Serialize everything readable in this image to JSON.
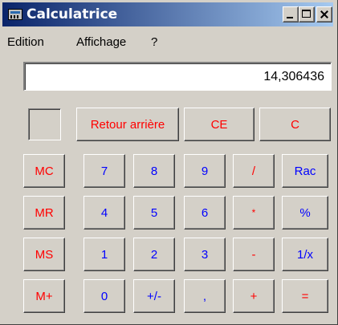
{
  "window": {
    "title": "Calculatrice",
    "icon": "calculator-icon"
  },
  "menu": {
    "edition": "Edition",
    "affichage": "Affichage",
    "help": "?"
  },
  "display": {
    "value": "14,306436"
  },
  "colors": {
    "title_gradient_start": "#0a246a",
    "title_gradient_end": "#a6caf0",
    "red_label": "#ff0000",
    "blue_label": "#0000ff",
    "face": "#d4d0c8"
  },
  "buttons": {
    "backspace": "Retour arrière",
    "ce": "CE",
    "c": "C",
    "mc": "MC",
    "mr": "MR",
    "ms": "MS",
    "mplus": "M+",
    "d7": "7",
    "d8": "8",
    "d9": "9",
    "div": "/",
    "sqrt": "Rac",
    "d4": "4",
    "d5": "5",
    "d6": "6",
    "mul": "*",
    "pct": "%",
    "d1": "1",
    "d2": "2",
    "d3": "3",
    "sub": "-",
    "inv": "1/x",
    "d0": "0",
    "sign": "+/-",
    "dot": ",",
    "add": "+",
    "eq": "="
  }
}
